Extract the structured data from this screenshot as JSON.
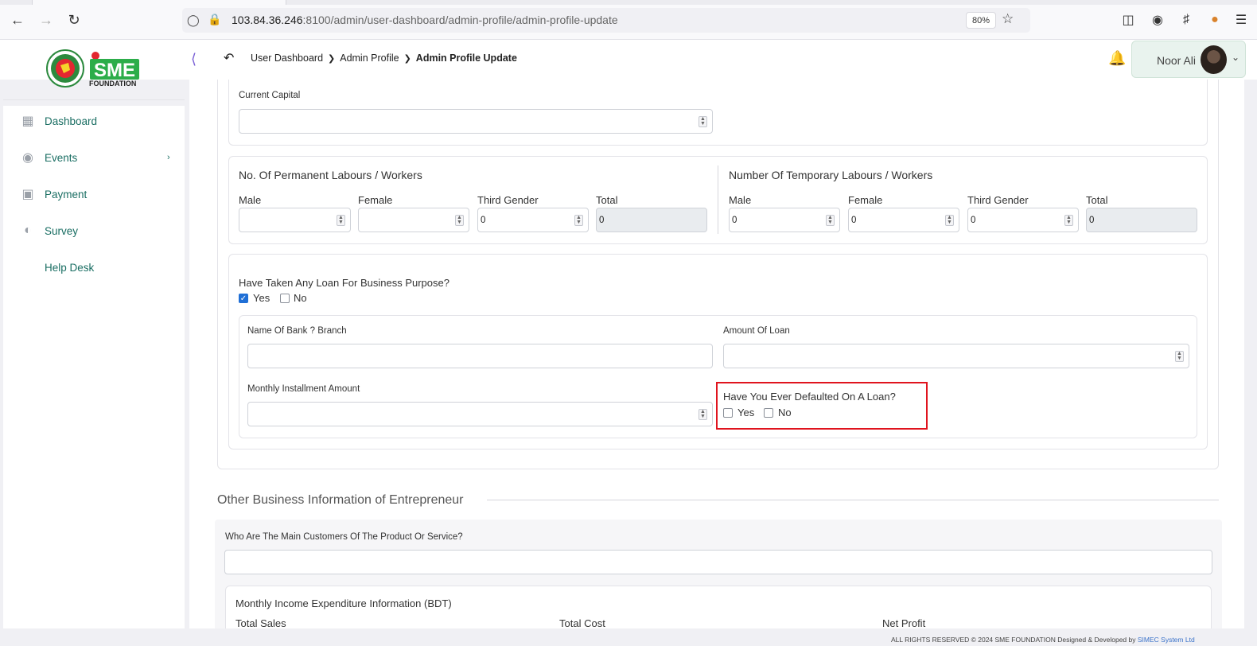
{
  "browser": {
    "url_host": "103.84.36.246",
    "url_rest": ":8100/admin/user-dashboard/admin-profile/admin-profile-update",
    "zoom": "80%"
  },
  "header": {
    "logo_text": "SME",
    "logo_subtext": "FOUNDATION",
    "breadcrumb": [
      "User Dashboard",
      "Admin Profile",
      "Admin Profile Update"
    ],
    "user_name": "Noor Ali"
  },
  "sidebar": {
    "items": [
      {
        "label": "Dashboard",
        "icon": "grid-icon"
      },
      {
        "label": "Events",
        "icon": "calendar-icon"
      },
      {
        "label": "Payment",
        "icon": "money-icon"
      },
      {
        "label": "Survey",
        "icon": "pie-icon"
      },
      {
        "label": "Help Desk",
        "icon": ""
      }
    ]
  },
  "form": {
    "current_capital_label": "Current Capital",
    "current_capital_value": "",
    "permanent": {
      "title": "No. Of Permanent Labours / Workers",
      "male_label": "Male",
      "male_value": "",
      "female_label": "Female",
      "female_value": "",
      "third_label": "Third Gender",
      "third_value": "0",
      "total_label": "Total",
      "total_value": "0"
    },
    "temporary": {
      "title": "Number Of Temporary Labours / Workers",
      "male_label": "Male",
      "male_value": "0",
      "female_label": "Female",
      "female_value": "0",
      "third_label": "Third Gender",
      "third_value": "0",
      "total_label": "Total",
      "total_value": "0"
    },
    "loan": {
      "question": "Have Taken Any Loan For Business Purpose?",
      "yes": "Yes",
      "no": "No",
      "yes_checked": true,
      "bank_label": "Name Of Bank ? Branch",
      "amount_label": "Amount Of Loan",
      "installment_label": "Monthly Installment Amount",
      "default_question": "Have You Ever Defaulted On A Loan?",
      "default_yes": "Yes",
      "default_no": "No"
    },
    "other_section_title": "Other Business Information of Entrepreneur",
    "customers_label": "Who Are The Main Customers Of The Product Or Service?",
    "monthly_title": "Monthly Income Expenditure Information (BDT)",
    "total_sales": "Total Sales",
    "total_cost": "Total Cost",
    "net_profit": "Net Profit"
  },
  "footer": {
    "text": "ALL RIGHTS RESERVED © 2024 SME FOUNDATION   Designed & Developed by",
    "link": "SIMEC System Ltd"
  }
}
